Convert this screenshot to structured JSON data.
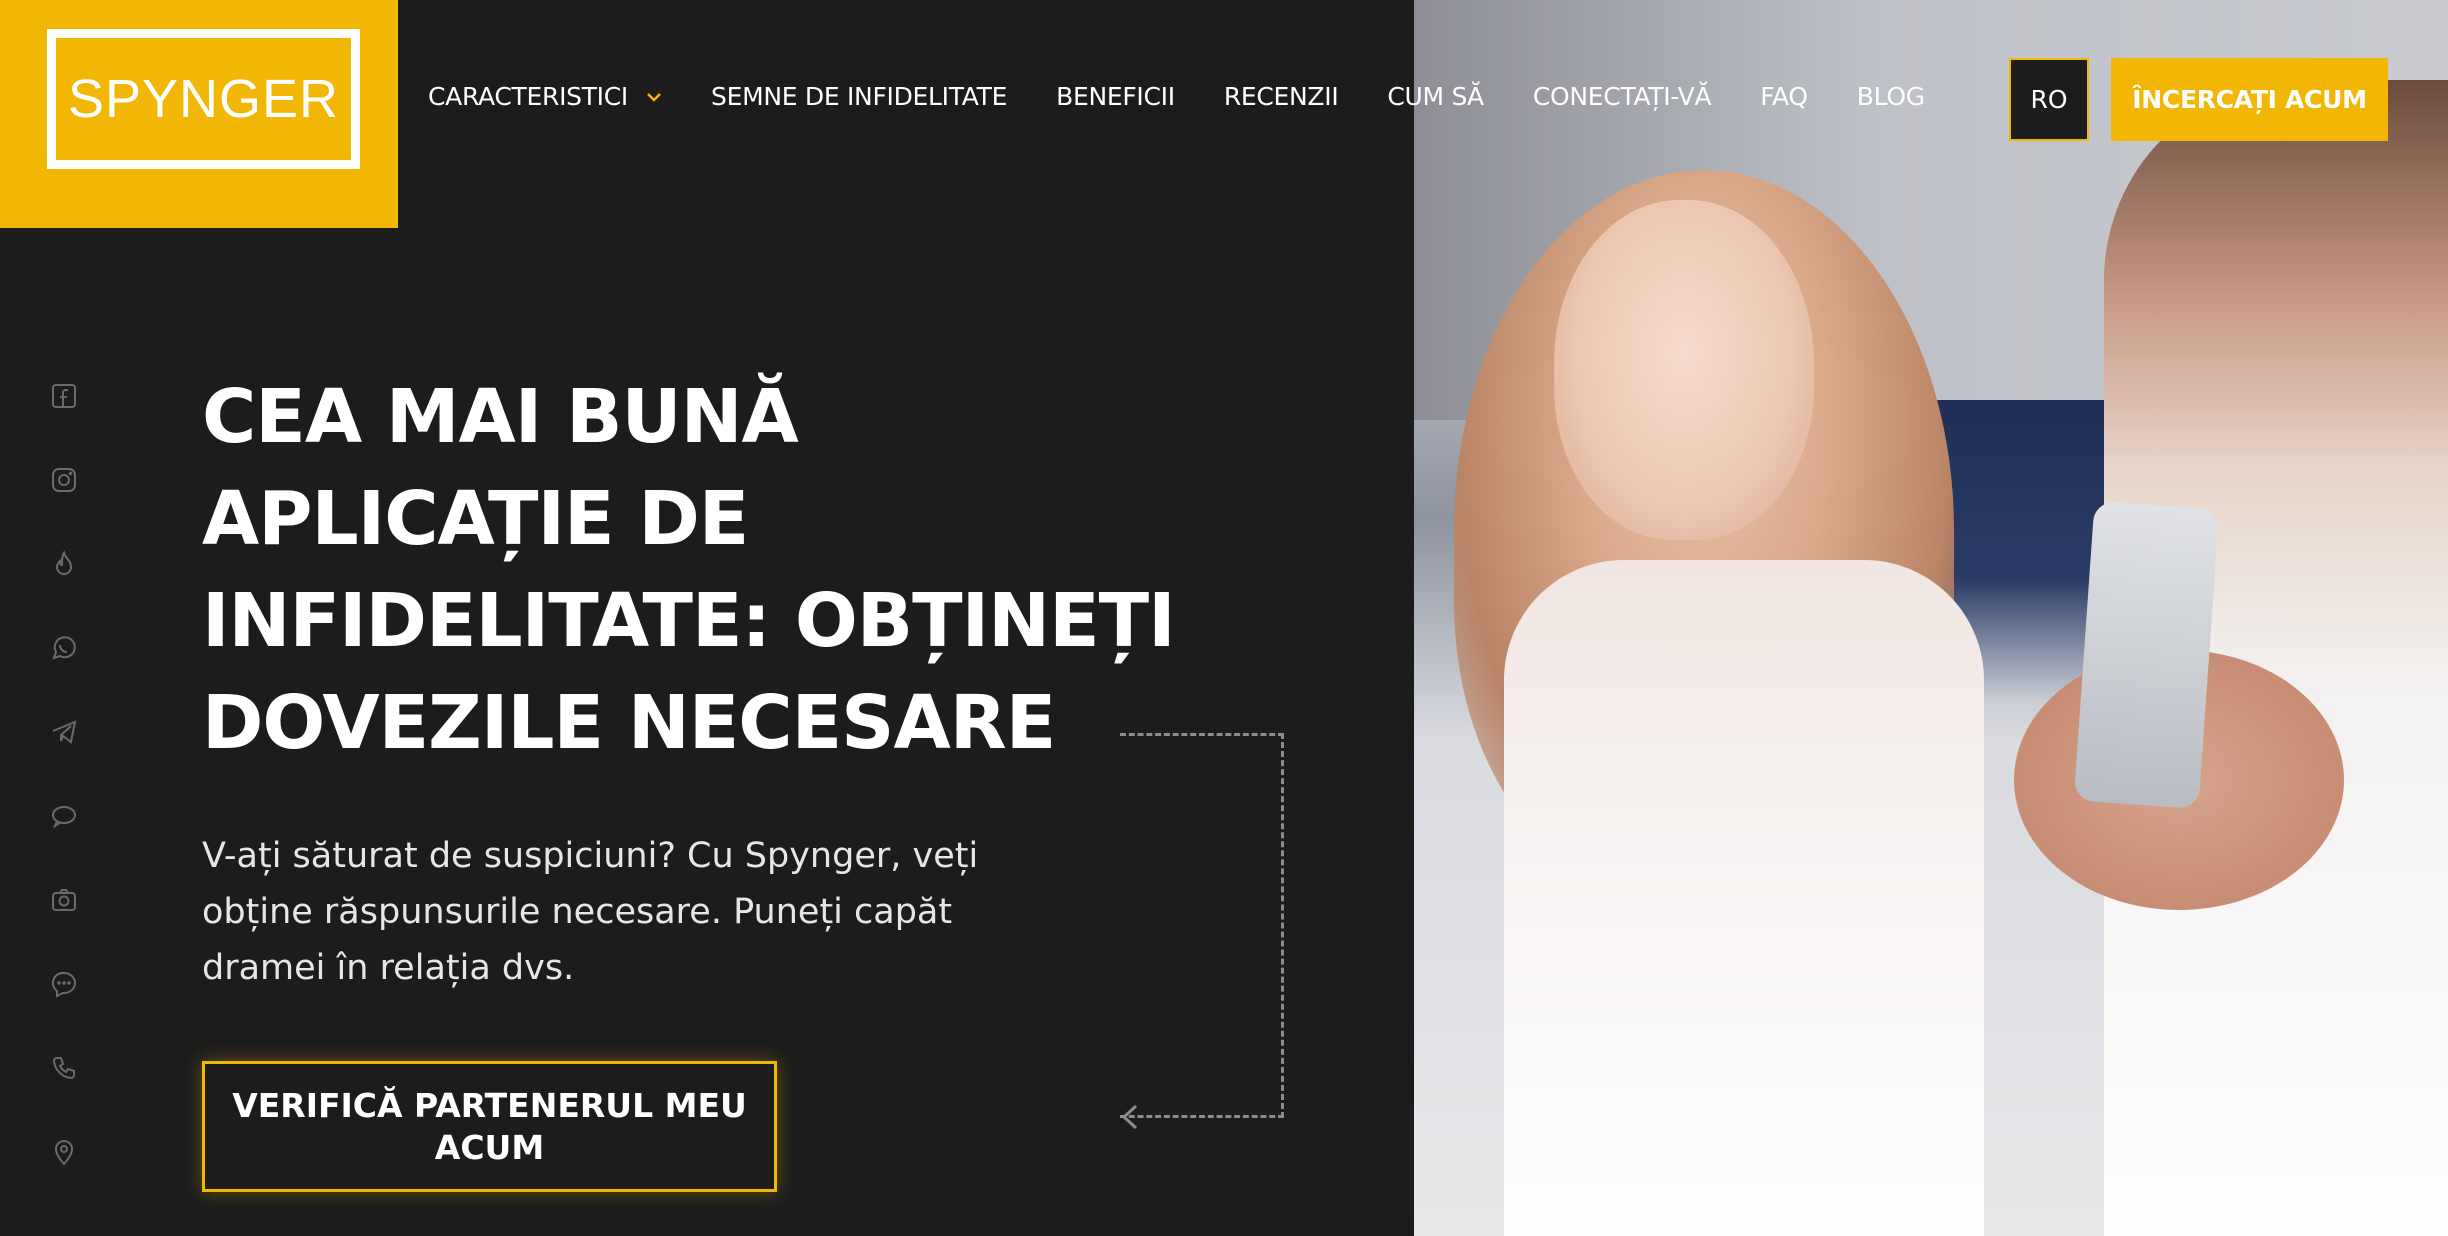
{
  "brand": {
    "logo_text": "SPYNGER",
    "accent_color": "#f2b705",
    "background_color": "#1c1c1d"
  },
  "nav": {
    "items": [
      {
        "label": "CARACTERISTICI",
        "has_dropdown": true
      },
      {
        "label": "SEMNE DE INFIDELITATE"
      },
      {
        "label": "BENEFICII"
      },
      {
        "label": "RECENZII"
      },
      {
        "label": "CUM SĂ"
      },
      {
        "label": "CONECTAȚI-VĂ"
      },
      {
        "label": "FAQ"
      },
      {
        "label": "BLOG"
      }
    ],
    "language": "RO",
    "try_button": "ÎNCERCAȚI ACUM"
  },
  "social_icons": [
    "facebook-icon",
    "instagram-icon",
    "tinder-icon",
    "whatsapp-icon",
    "telegram-icon",
    "imessage-icon",
    "camera-icon",
    "messenger-icon",
    "phone-icon",
    "location-icon"
  ],
  "hero": {
    "title_lines": [
      "CEA MAI BUNĂ",
      "APLICAȚIE DE",
      "INFIDELITATE: OBȚINEȚI",
      "DOVEZILE NECESARE"
    ],
    "subtitle_lines": [
      "V-ați săturat de suspiciuni? Cu Spynger, veți",
      "obține răspunsurile necesare. Puneți capăt",
      "dramei în relația dvs."
    ],
    "cta_lines": [
      "VERIFICĂ PARTENERUL MEU",
      "ACUM"
    ]
  },
  "image": {
    "alt": "hero-photo-couple"
  }
}
